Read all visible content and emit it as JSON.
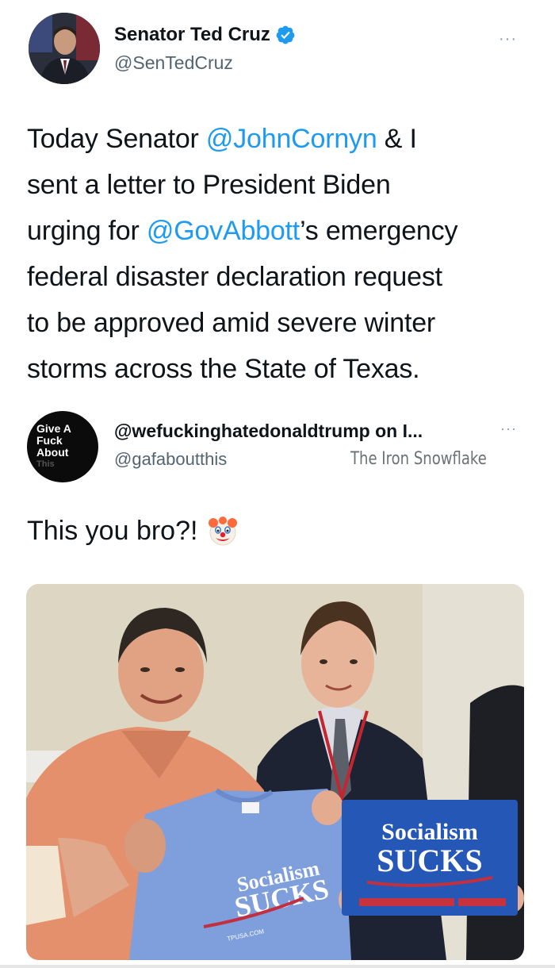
{
  "tweet": {
    "author_name": "Senator Ted Cruz",
    "author_handle": "@SenTedCruz",
    "more_label": "···",
    "lines": [
      [
        {
          "t": "Today Senator "
        },
        {
          "t": "@JohnCornyn",
          "m": true
        },
        {
          "t": " & I"
        }
      ],
      [
        {
          "t": "sent a letter to President Biden"
        }
      ],
      [
        {
          "t": "urging for "
        },
        {
          "t": "@GovAbbott",
          "m": true
        },
        {
          "t": "’s emergency"
        }
      ],
      [
        {
          "t": "federal disaster declaration request"
        }
      ],
      [
        {
          "t": "to be approved amid severe winter"
        }
      ],
      [
        {
          "t": "storms across the State of Texas."
        }
      ]
    ]
  },
  "quote": {
    "avatar_lines": [
      "Give A",
      "Fuck",
      "About",
      "This"
    ],
    "author_name": "@wefuckinghatedonaldtrump on I...",
    "author_handle": "@gafaboutthis",
    "watermark": "The Iron Snowflake",
    "more_label": "···",
    "text": "This you bro?!",
    "emoji": "clown-face"
  },
  "photo": {
    "shirt_text_line1": "Socialism",
    "shirt_text_line2": "SUCKS",
    "shirt_small_text": "TPUSA.COM",
    "sign_text_line1": "Socialism",
    "sign_text_line2": "SUCKS"
  },
  "colors": {
    "accent": "#1d9bf0",
    "text": "#0f1419",
    "muted": "#536471"
  }
}
